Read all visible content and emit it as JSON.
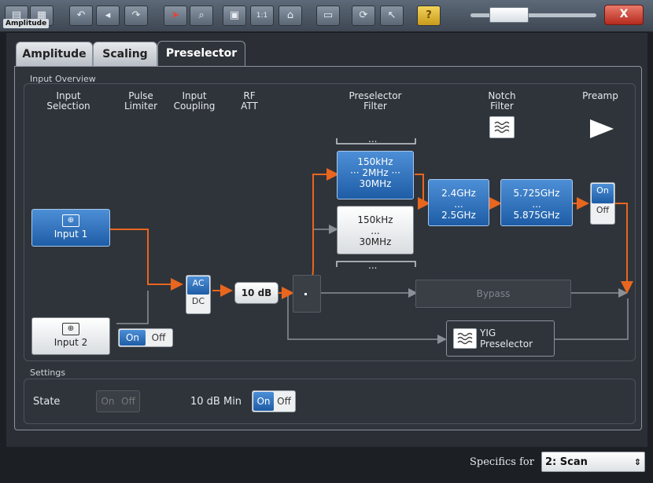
{
  "window": {
    "title": "Amplitude"
  },
  "toolbar": {
    "icons": [
      "save-icon",
      "print-icon",
      "undo-icon",
      "redo-icon",
      "pointer-icon",
      "marker-zoom-icon",
      "multi-view-icon",
      "one-to-one-icon",
      "home-icon",
      "display-icon",
      "refresh-icon",
      "help-pointer-icon",
      "help-icon"
    ],
    "help_label": "?",
    "close_label": "X"
  },
  "tabs": [
    {
      "label": "Amplitude"
    },
    {
      "label": "Scaling"
    },
    {
      "label": "Preselector"
    }
  ],
  "overview": {
    "group_label": "Input Overview",
    "columns": {
      "input_selection": "Input\nSelection",
      "pulse_limiter": "Pulse\nLimiter",
      "input_coupling": "Input\nCoupling",
      "rf_att": "RF\nATT",
      "preselector_filter": "Preselector\nFilter",
      "notch_filter": "Notch\nFilter",
      "preamp": "Preamp"
    },
    "input1": "Input 1",
    "input2": "Input 2",
    "pulse_toggle": {
      "on": "On",
      "off": "Off"
    },
    "coupling": {
      "ac": "AC",
      "dc": "DC"
    },
    "rf_att_value": "10 dB",
    "filters": {
      "top_ellipsis": "...",
      "band_a": "150kHz\n··· 2MHz ···\n30MHz",
      "band_b": "150kHz\n...\n30MHz",
      "bottom_ellipsis": "..."
    },
    "band_24": "2.4GHz\n...\n2.5GHz",
    "band_57": "5.725GHz\n...\n5.875GHz",
    "preamp_toggle": {
      "on": "On",
      "off": "Off"
    },
    "bypass": "Bypass",
    "yig": "YIG\nPreselector"
  },
  "settings": {
    "group_label": "Settings",
    "state_label": "State",
    "state_toggle": {
      "on": "On",
      "off": "Off"
    },
    "min_label": "10 dB Min",
    "min_toggle": {
      "on": "On",
      "off": "Off"
    }
  },
  "footer": {
    "specifics_label": "Specifics for",
    "specifics_value": "2: Scan"
  },
  "colors": {
    "accent": "#1e5da6",
    "signal": "#e8661f",
    "inactive_line": "#8a9096"
  }
}
